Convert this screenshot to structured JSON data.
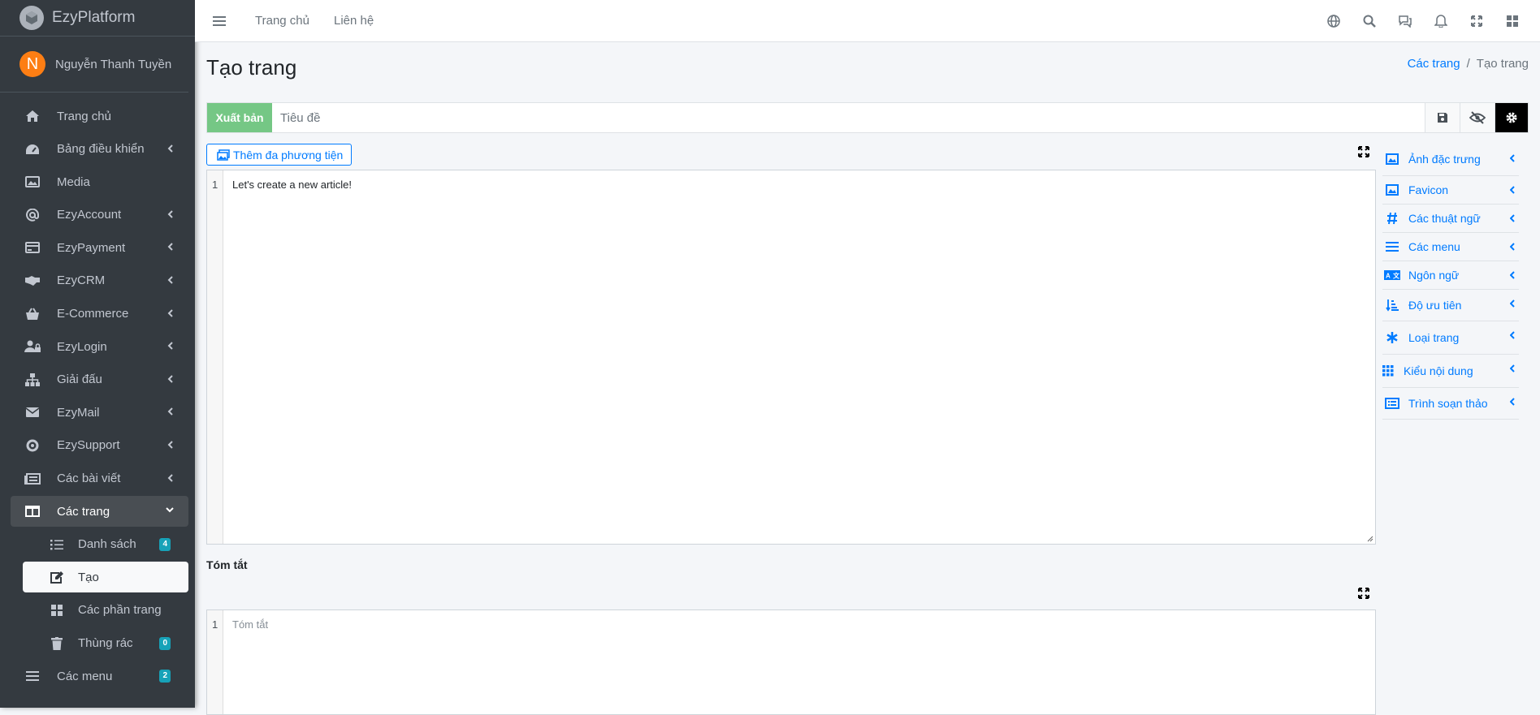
{
  "brand": {
    "name": "EzyPlatform"
  },
  "user": {
    "initial": "N",
    "name": "Nguyễn Thanh Tuyền"
  },
  "sidebar": {
    "items": [
      {
        "label": "Trang chủ",
        "icon": "home-icon"
      },
      {
        "label": "Bảng điều khiển",
        "icon": "dashboard-icon"
      },
      {
        "label": "Media",
        "icon": "image-icon"
      },
      {
        "label": "EzyAccount",
        "icon": "at-icon"
      },
      {
        "label": "EzyPayment",
        "icon": "credit-card-icon"
      },
      {
        "label": "EzyCRM",
        "icon": "handshake-icon"
      },
      {
        "label": "E-Commerce",
        "icon": "basket-icon"
      },
      {
        "label": "EzyLogin",
        "icon": "user-lock-icon"
      },
      {
        "label": "Giải đấu",
        "icon": "sitemap-icon"
      },
      {
        "label": "EzyMail",
        "icon": "envelope-icon"
      },
      {
        "label": "EzySupport",
        "icon": "life-ring-icon"
      },
      {
        "label": "Các bài viết",
        "icon": "newspaper-icon"
      },
      {
        "label": "Các trang",
        "icon": "columns-icon"
      }
    ],
    "sub_items": [
      {
        "label": "Danh sách",
        "badge": "4"
      },
      {
        "label": "Tạo"
      },
      {
        "label": "Các phần trang"
      },
      {
        "label": "Thùng rác",
        "badge": "0"
      }
    ],
    "menus": {
      "label": "Các menu",
      "badge": "2"
    }
  },
  "topbar": {
    "links": [
      "Trang chủ",
      "Liên hệ"
    ]
  },
  "page": {
    "title": "Tạo trang"
  },
  "breadcrumb": {
    "parent": "Các trang",
    "separator": "/",
    "current": "Tạo trang"
  },
  "editor": {
    "publish_label": "Xuất bản",
    "title_placeholder": "Tiêu đề",
    "add_media_label": "Thêm đa phương tiện",
    "line_number": "1",
    "content": "Let's create a new article!",
    "summary_label": "Tóm tắt",
    "summary_placeholder": "Tóm tắt"
  },
  "right_panel": {
    "items": [
      {
        "label": "Ảnh đặc trưng",
        "icon": "image-icon"
      },
      {
        "label": "Favicon",
        "icon": "image-icon"
      },
      {
        "label": "Các thuật ngữ",
        "icon": "hashtag-icon"
      },
      {
        "label": "Các menu",
        "icon": "bars-icon"
      },
      {
        "label": "Ngôn ngữ",
        "icon": "language-icon"
      },
      {
        "label": "Độ ưu tiên",
        "icon": "sort-icon"
      },
      {
        "label": "Loại trang",
        "icon": "asterisk-icon"
      },
      {
        "label": "Kiểu nội dung",
        "icon": "grid-icon"
      },
      {
        "label": "Trình soạn thảo",
        "icon": "list-alt-icon"
      }
    ]
  },
  "colors": {
    "sidebar_bg": "#343a40",
    "accent": "#007bff",
    "publish": "#75c785",
    "badge": "#17a2b8"
  }
}
